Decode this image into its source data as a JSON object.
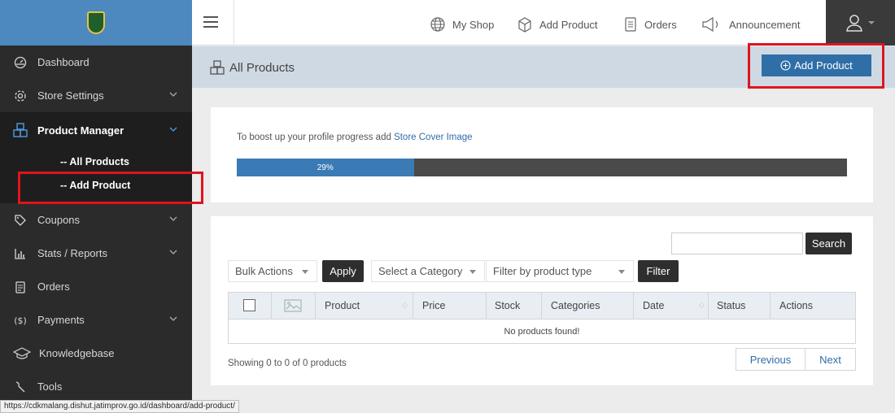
{
  "sidebar": {
    "items": [
      {
        "label": "Dashboard",
        "icon": "dashboard-icon"
      },
      {
        "label": "Store Settings",
        "icon": "gear-icon"
      },
      {
        "label": "Product Manager",
        "icon": "product-icon"
      },
      {
        "label": "Coupons",
        "icon": "tag-icon"
      },
      {
        "label": "Stats / Reports",
        "icon": "chart-icon"
      },
      {
        "label": "Orders",
        "icon": "clipboard-icon"
      },
      {
        "label": "Payments",
        "icon": "dollar-icon"
      },
      {
        "label": "Knowledgebase",
        "icon": "graduation-icon"
      },
      {
        "label": "Tools",
        "icon": "wrench-icon"
      }
    ],
    "submenu": [
      "-- All Products",
      "-- Add Product"
    ]
  },
  "topbar": {
    "links": [
      "My Shop",
      "Add Product",
      "Orders",
      "Announcement"
    ]
  },
  "page": {
    "title": "All Products",
    "add_button": "Add Product"
  },
  "progress": {
    "text": "To boost up your profile progress add ",
    "link": "Store Cover Image",
    "percent_label": "29%",
    "percent": 29
  },
  "filters": {
    "bulk_actions": "Bulk Actions",
    "apply": "Apply",
    "category": "Select a Category",
    "product_type": "Filter by product type",
    "filter": "Filter",
    "search_button": "Search"
  },
  "table": {
    "columns": [
      "Product",
      "Price",
      "Stock",
      "Categories",
      "Date",
      "Status",
      "Actions"
    ],
    "empty_message": "No products found!"
  },
  "pagination": {
    "showing": "Showing 0 to 0 of 0 products",
    "previous": "Previous",
    "next": "Next"
  },
  "status_url": "https://cdkmalang.dishut.jatimprov.go.id/dashboard/add-product/",
  "colors": {
    "accent": "#2f6ea7",
    "sidebar_bg": "#2b2b2b",
    "highlight": "#e0141e"
  }
}
